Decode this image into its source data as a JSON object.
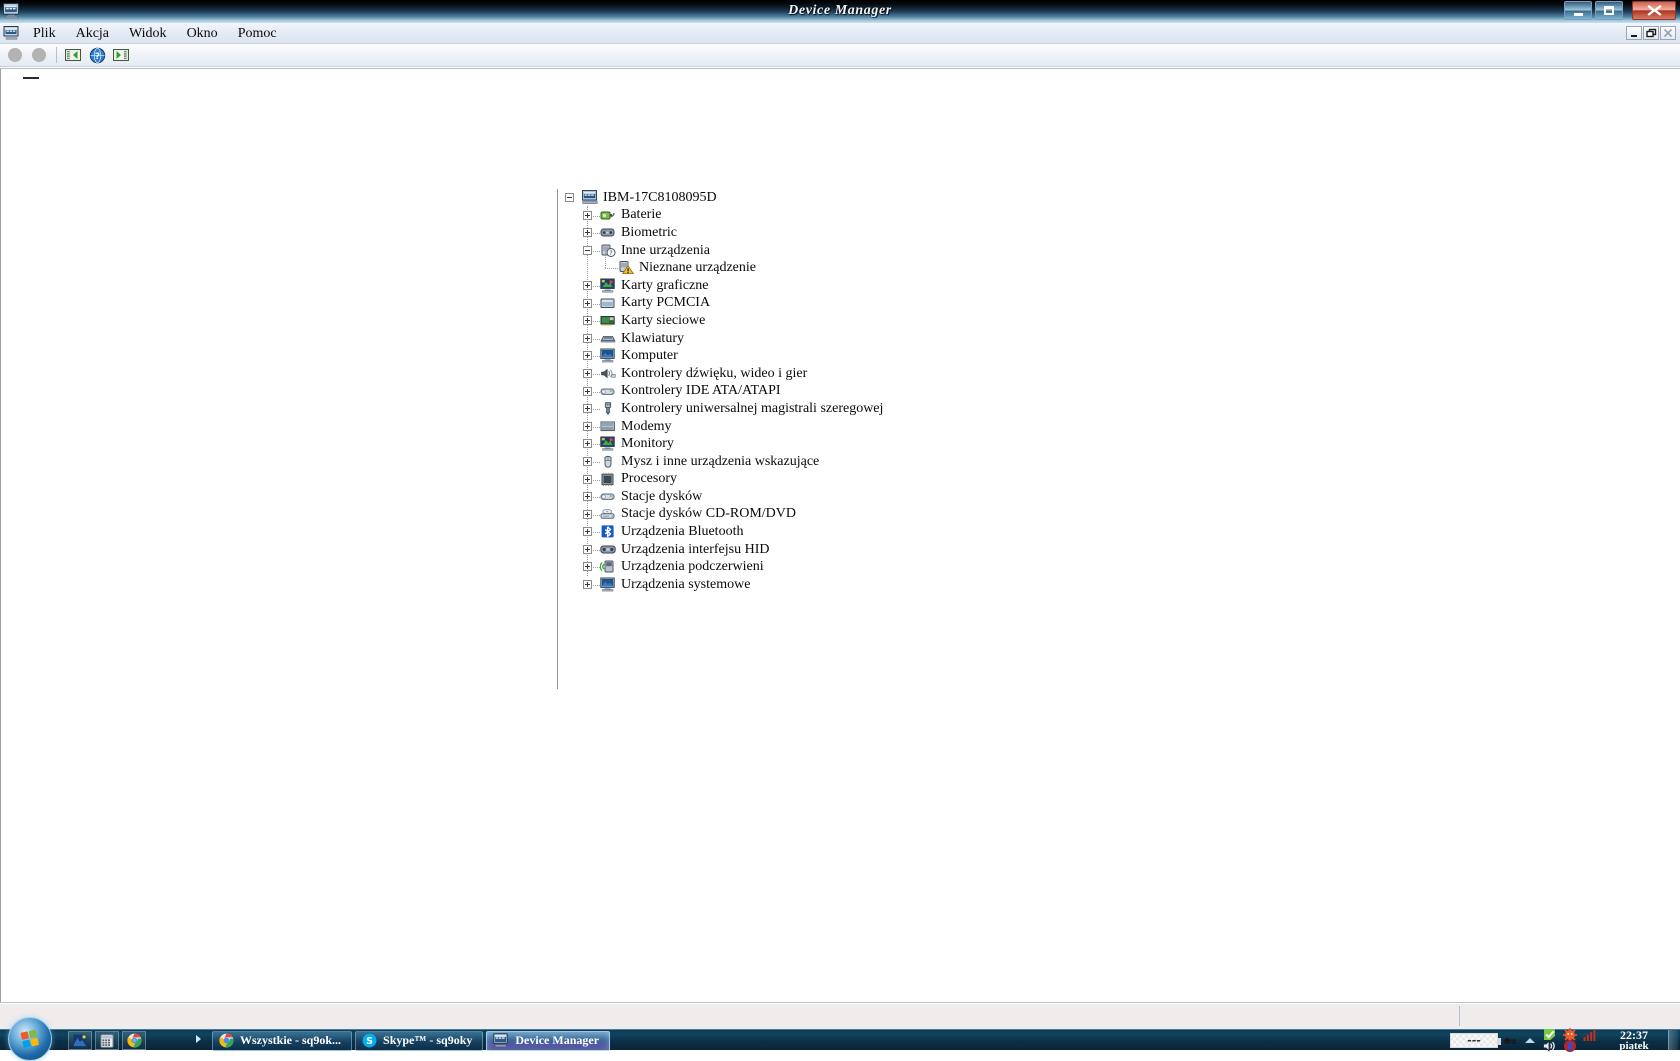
{
  "window": {
    "title": "Device Manager",
    "icon": "device-manager-icon",
    "controls": {
      "minimize": "Minimize",
      "maximize": "Maximize",
      "close": "Close"
    },
    "mini_controls": {
      "minimize": "_",
      "restore": "⧉",
      "close": "✕"
    }
  },
  "menubar": {
    "items": [
      {
        "label": "Plik",
        "name": "menu-file"
      },
      {
        "label": "Akcja",
        "name": "menu-action"
      },
      {
        "label": "Widok",
        "name": "menu-view"
      },
      {
        "label": "Okno",
        "name": "menu-window"
      },
      {
        "label": "Pomoc",
        "name": "menu-help"
      }
    ]
  },
  "toolbar": {
    "buttons": [
      {
        "name": "back-button",
        "icon": "back-circle-icon",
        "enabled": false
      },
      {
        "name": "forward-button",
        "icon": "forward-circle-icon",
        "enabled": false
      },
      {
        "name": "show-console-tree-button",
        "icon": "console-tree-icon",
        "enabled": true
      },
      {
        "name": "help-button",
        "icon": "help-globe-icon",
        "enabled": true
      },
      {
        "name": "show-action-pane-button",
        "icon": "action-pane-icon",
        "enabled": true
      }
    ]
  },
  "tree": {
    "root": {
      "label": "IBM-17C8108095D",
      "icon": "computer-icon",
      "expanded": true
    },
    "items": [
      {
        "label": "Baterie",
        "icon": "battery-icon",
        "depth": 1,
        "expanded": false
      },
      {
        "label": "Biometric",
        "icon": "biometric-icon",
        "depth": 1,
        "expanded": false
      },
      {
        "label": "Inne urządzenia",
        "icon": "other-devices-icon",
        "depth": 1,
        "expanded": true
      },
      {
        "label": "Nieznane urządzenie",
        "icon": "unknown-device-warning-icon",
        "depth": 2,
        "expanded": null
      },
      {
        "label": "Karty graficzne",
        "icon": "display-adapter-icon",
        "depth": 1,
        "expanded": false
      },
      {
        "label": "Karty PCMCIA",
        "icon": "pcmcia-icon",
        "depth": 1,
        "expanded": false
      },
      {
        "label": "Karty sieciowe",
        "icon": "network-adapter-icon",
        "depth": 1,
        "expanded": false
      },
      {
        "label": "Klawiatury",
        "icon": "keyboard-icon",
        "depth": 1,
        "expanded": false
      },
      {
        "label": "Komputer",
        "icon": "computer-icon",
        "depth": 1,
        "expanded": false
      },
      {
        "label": "Kontrolery dźwięku, wideo i gier",
        "icon": "sound-video-game-icon",
        "depth": 1,
        "expanded": false
      },
      {
        "label": "Kontrolery IDE ATA/ATAPI",
        "icon": "ide-controller-icon",
        "depth": 1,
        "expanded": false
      },
      {
        "label": "Kontrolery uniwersalnej magistrali szeregowej",
        "icon": "usb-controller-icon",
        "depth": 1,
        "expanded": false
      },
      {
        "label": "Modemy",
        "icon": "modem-icon",
        "depth": 1,
        "expanded": false
      },
      {
        "label": "Monitory",
        "icon": "monitor-icon",
        "depth": 1,
        "expanded": false
      },
      {
        "label": "Mysz i inne urządzenia wskazujące",
        "icon": "mouse-icon",
        "depth": 1,
        "expanded": false
      },
      {
        "label": "Procesory",
        "icon": "processor-icon",
        "depth": 1,
        "expanded": false
      },
      {
        "label": "Stacje dysków",
        "icon": "disk-drive-icon",
        "depth": 1,
        "expanded": false
      },
      {
        "label": "Stacje dysków CD-ROM/DVD",
        "icon": "cdrom-drive-icon",
        "depth": 1,
        "expanded": false
      },
      {
        "label": "Urządzenia Bluetooth",
        "icon": "bluetooth-icon",
        "depth": 1,
        "expanded": false
      },
      {
        "label": "Urządzenia interfejsu HID",
        "icon": "hid-device-icon",
        "depth": 1,
        "expanded": false
      },
      {
        "label": "Urządzenia podczerwieni",
        "icon": "infrared-device-icon",
        "depth": 1,
        "expanded": false
      },
      {
        "label": "Urządzenia systemowe",
        "icon": "system-device-icon",
        "depth": 1,
        "expanded": false
      }
    ]
  },
  "statusbar": {
    "text": ""
  },
  "taskbar": {
    "start_button": "start-orb",
    "quick_launch": [
      {
        "name": "ql-show-desktop",
        "icon": "show-desktop-icon"
      },
      {
        "name": "ql-calculator",
        "icon": "calculator-icon"
      },
      {
        "name": "ql-chrome",
        "icon": "chrome-icon"
      }
    ],
    "quick_launch_overflow": "▶",
    "tasks": [
      {
        "label": "Wszystkie - sq9ok...",
        "icon": "chrome-icon",
        "active": false
      },
      {
        "label": "Skype™ - sq9oky",
        "icon": "skype-icon",
        "active": false
      },
      {
        "label": "Device Manager",
        "icon": "device-manager-icon",
        "active": true
      }
    ],
    "tray": {
      "battery_label": "---",
      "icons": [
        {
          "name": "power-plug-icon"
        },
        {
          "name": "show-hidden-icons-arrow"
        },
        {
          "name": "green-check-icon"
        },
        {
          "name": "antivirus-icon"
        },
        {
          "name": "network-signal-icon"
        },
        {
          "name": "volume-speaker-icon"
        },
        {
          "name": "bluetooth-tray-icon"
        }
      ],
      "clock_time": "22:37",
      "clock_day": "piątek"
    }
  },
  "colors": {
    "title_bar_start": "#000000",
    "title_bar_end": "#cfe2ee",
    "taskbar": "#0c3047",
    "window_face": "#ffffff",
    "status_face": "#f0ecec",
    "close_button": "#b03424"
  }
}
